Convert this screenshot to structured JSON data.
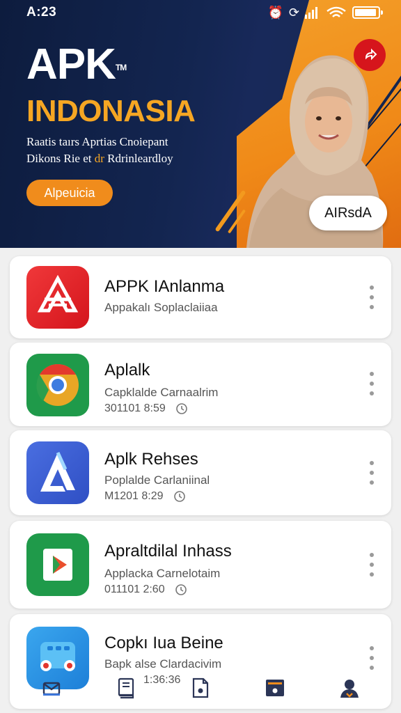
{
  "status_bar": {
    "time": "A:23"
  },
  "hero": {
    "logo": "APK",
    "logo_tm": "TM",
    "brand_sub": "INDONASIA",
    "tagline_line1": "Raatis taırs Aprtias Cnoiepant",
    "tagline_line2_pre": "Dikons Rie et ",
    "tagline_line2_accent": "dr",
    "tagline_line2_post": " Rdrinleardloy",
    "cta_label": "Alpeuicia",
    "pill_label": "AIRsdA",
    "colors": {
      "navy": "#0d1c3e",
      "orange": "#f08c1c",
      "gold": "#f5a623",
      "red": "#d6151c"
    }
  },
  "apps": [
    {
      "title": "APPK IAnlanma",
      "subtitle": "Appakalı  Soplaclaiiaa",
      "meta": "",
      "icon": "red-apk-icon"
    },
    {
      "title": "Aplalk",
      "subtitle": "Capklalde Carnaalrim",
      "meta": "301101 8:59",
      "icon": "chrome-style-icon"
    },
    {
      "title": "Aplk Rehses",
      "subtitle": "Poplalde Carlaniinal",
      "meta": "M1201 8:29",
      "icon": "blue-a-icon"
    },
    {
      "title": "Apraltdilal Inhass",
      "subtitle": "Applacka Carnelotaim",
      "meta": "011101 2:60",
      "icon": "green-play-icon"
    },
    {
      "title": "Copkı Iua Beine",
      "subtitle": "Bapk alse Clardacivim",
      "meta": "1:36:36",
      "icon": "blue-robot-icon"
    }
  ],
  "bottom_nav": [
    "inbox-icon",
    "book-icon",
    "file-icon",
    "folder-icon",
    "profile-icon"
  ]
}
